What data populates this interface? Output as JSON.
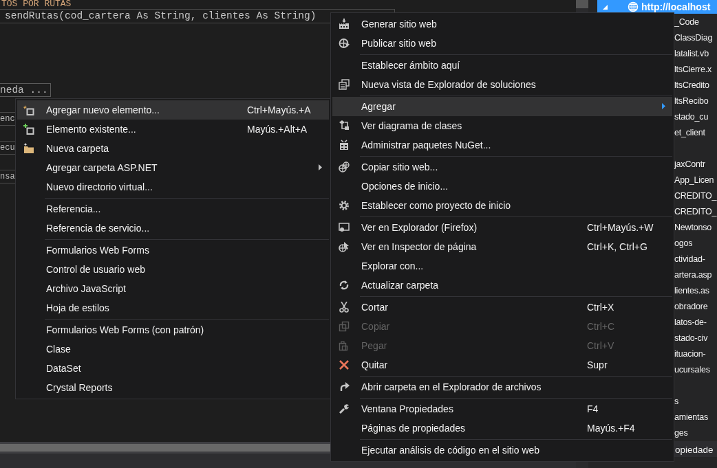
{
  "editor": {
    "lines": [
      {
        "kind": "header",
        "text": "TOS POR RUTAS"
      },
      {
        "kind": "signature",
        "text": "sendRutas(cod_cartera As String, clientes As String)"
      },
      {
        "kind": "search",
        "text": "neda ..."
      },
      {
        "kind": "fragment",
        "text": "enc"
      },
      {
        "kind": "fragment",
        "text": "ecu"
      },
      {
        "kind": "fragment",
        "text": "nsa"
      }
    ]
  },
  "solution_explorer": {
    "root": {
      "label": "http://localhost",
      "selected": true,
      "expanded": true
    },
    "items": [
      {
        "label": "_Code",
        "selected": false,
        "gap_before": false
      },
      {
        "label": "ClassDiag",
        "selected": false,
        "gap_before": false
      },
      {
        "label": "latalist.vb",
        "selected": false,
        "gap_before": false
      },
      {
        "label": "ltsCierre.x",
        "selected": false,
        "gap_before": false
      },
      {
        "label": "ltsCredito",
        "selected": false,
        "gap_before": false
      },
      {
        "label": "ltsRecibo",
        "selected": false,
        "gap_before": false
      },
      {
        "label": "stado_cu",
        "selected": false,
        "gap_before": false
      },
      {
        "label": "et_client",
        "selected": false,
        "gap_before": false
      },
      {
        "label": "jaxContr",
        "selected": false,
        "gap_before": true
      },
      {
        "label": "App_Licen",
        "selected": false,
        "gap_before": false
      },
      {
        "label": "CREDITO_",
        "selected": false,
        "gap_before": false
      },
      {
        "label": "CREDITO_",
        "selected": false,
        "gap_before": false
      },
      {
        "label": "Newtonso",
        "selected": false,
        "gap_before": false
      },
      {
        "label": "ogos",
        "selected": false,
        "gap_before": false
      },
      {
        "label": "ctividad-",
        "selected": false,
        "gap_before": false
      },
      {
        "label": "artera.asp",
        "selected": false,
        "gap_before": false
      },
      {
        "label": "lientes.as",
        "selected": false,
        "gap_before": false
      },
      {
        "label": "obradore",
        "selected": false,
        "gap_before": false
      },
      {
        "label": "latos-de-",
        "selected": false,
        "gap_before": false
      },
      {
        "label": "stado-civ",
        "selected": false,
        "gap_before": false
      },
      {
        "label": "ituacion-",
        "selected": false,
        "gap_before": false
      },
      {
        "label": "ucursales",
        "selected": false,
        "gap_before": false
      },
      {
        "label": "s",
        "selected": false,
        "gap_before": true
      },
      {
        "label": "amientas",
        "selected": false,
        "gap_before": false
      },
      {
        "label": "ges",
        "selected": false,
        "gap_before": false
      }
    ],
    "bottom_tab": "opiedade"
  },
  "left_menu": {
    "groups": [
      {
        "items": [
          {
            "label": "Agregar nuevo elemento...",
            "shortcut": "Ctrl+Mayús.+A",
            "selected": true,
            "submenu": false
          },
          {
            "label": "Elemento existente...",
            "shortcut": "Mayús.+Alt+A",
            "selected": false,
            "submenu": false
          },
          {
            "label": "Nueva carpeta",
            "selected": false,
            "submenu": false
          },
          {
            "label": "Agregar carpeta ASP.NET",
            "selected": false,
            "submenu": true
          },
          {
            "label": "Nuevo directorio virtual...",
            "selected": false,
            "submenu": false
          }
        ]
      },
      {
        "items": [
          {
            "label": "Referencia...",
            "selected": false,
            "submenu": false
          },
          {
            "label": "Referencia de servicio...",
            "selected": false,
            "submenu": false
          }
        ]
      },
      {
        "items": [
          {
            "label": "Formularios Web Forms",
            "selected": false,
            "submenu": false
          },
          {
            "label": "Control de usuario web",
            "selected": false,
            "submenu": false
          },
          {
            "label": "Archivo JavaScript",
            "selected": false,
            "submenu": false
          },
          {
            "label": "Hoja de estilos",
            "selected": false,
            "submenu": false
          }
        ]
      },
      {
        "items": [
          {
            "label": "Formularios Web Forms (con patrón)",
            "selected": false,
            "submenu": false
          },
          {
            "label": "Clase",
            "selected": false,
            "submenu": false
          },
          {
            "label": "DataSet",
            "selected": false,
            "submenu": false
          },
          {
            "label": "Crystal Reports",
            "selected": false,
            "submenu": false
          }
        ]
      }
    ]
  },
  "right_menu": {
    "groups": [
      {
        "items": [
          {
            "label": "Generar sitio web",
            "selected": false,
            "disabled": false,
            "submenu": false
          },
          {
            "label": "Publicar sitio web",
            "selected": false,
            "disabled": false,
            "submenu": false
          }
        ]
      },
      {
        "items": [
          {
            "label": "Establecer ámbito aquí",
            "selected": false,
            "disabled": false,
            "submenu": false
          },
          {
            "label": "Nueva vista de Explorador de soluciones",
            "selected": false,
            "disabled": false,
            "submenu": false
          }
        ]
      },
      {
        "items": [
          {
            "label": "Agregar",
            "selected": true,
            "disabled": false,
            "submenu": true
          },
          {
            "label": "Ver diagrama de clases",
            "selected": false,
            "disabled": false,
            "submenu": false
          },
          {
            "label": "Administrar paquetes NuGet...",
            "selected": false,
            "disabled": false,
            "submenu": false
          }
        ]
      },
      {
        "items": [
          {
            "label": "Copiar sitio web...",
            "selected": false,
            "disabled": false,
            "submenu": false
          },
          {
            "label": "Opciones de inicio...",
            "selected": false,
            "disabled": false,
            "submenu": false
          },
          {
            "label": "Establecer como proyecto de inicio",
            "selected": false,
            "disabled": false,
            "submenu": false
          }
        ]
      },
      {
        "items": [
          {
            "label": "Ver en Explorador (Firefox)",
            "shortcut": "Ctrl+Mayús.+W",
            "selected": false,
            "disabled": false,
            "submenu": false
          },
          {
            "label": "Ver en Inspector de página",
            "shortcut": "Ctrl+K, Ctrl+G",
            "selected": false,
            "disabled": false,
            "submenu": false
          },
          {
            "label": "Explorar con...",
            "selected": false,
            "disabled": false,
            "submenu": false
          },
          {
            "label": "Actualizar carpeta",
            "selected": false,
            "disabled": false,
            "submenu": false
          }
        ]
      },
      {
        "items": [
          {
            "label": "Cortar",
            "shortcut": "Ctrl+X",
            "selected": false,
            "disabled": false,
            "submenu": false
          },
          {
            "label": "Copiar",
            "shortcut": "Ctrl+C",
            "selected": false,
            "disabled": true,
            "submenu": false
          },
          {
            "label": "Pegar",
            "shortcut": "Ctrl+V",
            "selected": false,
            "disabled": true,
            "submenu": false
          },
          {
            "label": "Quitar",
            "shortcut": "Supr",
            "selected": false,
            "disabled": false,
            "submenu": false
          }
        ]
      },
      {
        "items": [
          {
            "label": "Abrir carpeta en el Explorador de archivos",
            "selected": false,
            "disabled": false,
            "submenu": false
          }
        ]
      },
      {
        "items": [
          {
            "label": "Ventana Propiedades",
            "shortcut": "F4",
            "selected": false,
            "disabled": false,
            "submenu": false
          },
          {
            "label": "Páginas de propiedades",
            "shortcut": "Mayús.+F4",
            "selected": false,
            "disabled": false,
            "submenu": false
          }
        ]
      },
      {
        "items": [
          {
            "label": "Ejecutar análisis de código en el sitio web",
            "selected": false,
            "disabled": false,
            "submenu": false
          }
        ]
      }
    ]
  }
}
